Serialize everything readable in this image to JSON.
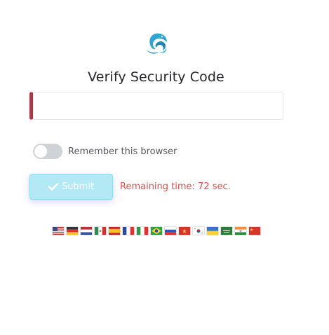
{
  "title": "Verify Security Code",
  "code_input": {
    "value": "",
    "placeholder": ""
  },
  "remember": {
    "label": "Remember this browser",
    "checked": false
  },
  "submit": {
    "label": "Submit",
    "icon": "check-icon"
  },
  "remaining_time": "Remaining time: 72 sec.",
  "colors": {
    "accent_error": "#a83b45",
    "remaining_text": "#e04b4b",
    "submit_bg": "#b2e9f4",
    "logo": "#2fa4cf"
  },
  "flags": [
    {
      "name": "flag-us",
      "lang": "English"
    },
    {
      "name": "flag-de",
      "lang": "German"
    },
    {
      "name": "flag-nl",
      "lang": "Dutch"
    },
    {
      "name": "flag-mx",
      "lang": "Spanish (Mexico)"
    },
    {
      "name": "flag-es",
      "lang": "Spanish"
    },
    {
      "name": "flag-fr",
      "lang": "French"
    },
    {
      "name": "flag-it",
      "lang": "Italian"
    },
    {
      "name": "flag-br",
      "lang": "Portuguese (Brazil)"
    },
    {
      "name": "flag-ru",
      "lang": "Russian"
    },
    {
      "name": "flag-vn",
      "lang": "Vietnamese"
    },
    {
      "name": "flag-kr",
      "lang": "Korean"
    },
    {
      "name": "flag-ua",
      "lang": "Ukrainian"
    },
    {
      "name": "flag-sa",
      "lang": "Arabic"
    },
    {
      "name": "flag-in",
      "lang": "Hindi"
    },
    {
      "name": "flag-cn",
      "lang": "Chinese"
    }
  ]
}
